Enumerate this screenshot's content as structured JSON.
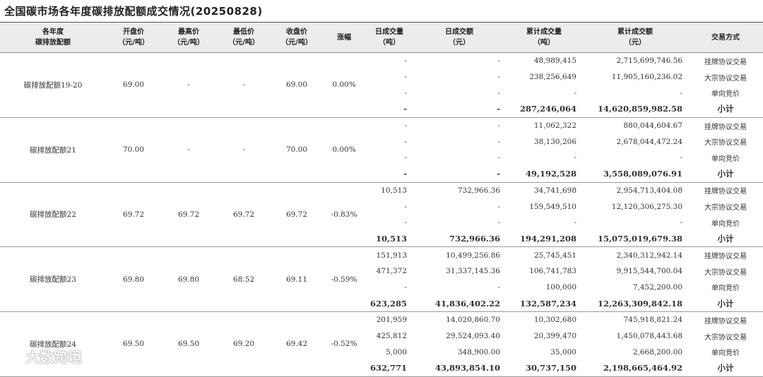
{
  "title": "全国碳市场各年度碳排放配额成交情况(20250828)",
  "headers": [
    [
      "各年度",
      "碳排放配额"
    ],
    [
      "开盘价",
      "（元/吨）"
    ],
    [
      "最高价",
      "（元/吨）"
    ],
    [
      "最低价",
      "（元/吨）"
    ],
    [
      "收盘价",
      "（元/吨）"
    ],
    [
      "涨幅"
    ],
    [
      "日成交量",
      "（吨）"
    ],
    [
      "日成交额",
      "（元）"
    ],
    [
      "累计成交量",
      "（吨）"
    ],
    [
      "累计成交额",
      "（元）"
    ],
    [
      "交易方式"
    ]
  ],
  "groups": [
    {
      "name": "碳排放配额19-20",
      "open": "69.00",
      "high": "-",
      "low": "-",
      "close": "69.00",
      "change": "0.00%",
      "rows": [
        {
          "vol": "-",
          "amt": "-",
          "cum_vol": "48,989,415",
          "cum_amt": "2,715,699,746.56",
          "method": "挂牌协议交易"
        },
        {
          "vol": "-",
          "amt": "-",
          "cum_vol": "238,256,649",
          "cum_amt": "11,905,160,236.02",
          "method": "大宗协议交易"
        },
        {
          "vol": "-",
          "amt": "-",
          "cum_vol": "-",
          "cum_amt": "-",
          "method": "单向竞价"
        },
        {
          "vol": "-",
          "amt": "-",
          "cum_vol": "287,246,064",
          "cum_amt": "14,620,859,982.58",
          "method": "小计"
        }
      ]
    },
    {
      "name": "碳排放配额21",
      "open": "70.00",
      "high": "-",
      "low": "-",
      "close": "70.00",
      "change": "0.00%",
      "rows": [
        {
          "vol": "-",
          "amt": "-",
          "cum_vol": "11,062,322",
          "cum_amt": "880,044,604.67",
          "method": "挂牌协议交易"
        },
        {
          "vol": "-",
          "amt": "-",
          "cum_vol": "38,130,206",
          "cum_amt": "2,678,044,472.24",
          "method": "大宗协议交易"
        },
        {
          "vol": "-",
          "amt": "-",
          "cum_vol": "-",
          "cum_amt": "-",
          "method": "单向竞价"
        },
        {
          "vol": "-",
          "amt": "-",
          "cum_vol": "49,192,528",
          "cum_amt": "3,558,089,076.91",
          "method": "小计"
        }
      ]
    },
    {
      "name": "碳排放配额22",
      "open": "69.72",
      "high": "69.72",
      "low": "69.72",
      "close": "69.72",
      "change": "-0.83%",
      "rows": [
        {
          "vol": "10,513",
          "amt": "732,966.36",
          "cum_vol": "34,741,698",
          "cum_amt": "2,954,713,404.08",
          "method": "挂牌协议交易"
        },
        {
          "vol": "-",
          "amt": "-",
          "cum_vol": "159,549,510",
          "cum_amt": "12,120,306,275.30",
          "method": "大宗协议交易"
        },
        {
          "vol": "-",
          "amt": "-",
          "cum_vol": "-",
          "cum_amt": "-",
          "method": "单向竞价"
        },
        {
          "vol": "10,513",
          "amt": "732,966.36",
          "cum_vol": "194,291,208",
          "cum_amt": "15,075,019,679.38",
          "method": "小计"
        }
      ]
    },
    {
      "name": "碳排放配额23",
      "open": "69.80",
      "high": "69.80",
      "low": "68.52",
      "close": "69.11",
      "change": "-0.59%",
      "rows": [
        {
          "vol": "151,913",
          "amt": "10,499,256.86",
          "cum_vol": "25,745,451",
          "cum_amt": "2,340,312,942.14",
          "method": "挂牌协议交易"
        },
        {
          "vol": "471,372",
          "amt": "31,337,145.36",
          "cum_vol": "106,741,783",
          "cum_amt": "9,915,544,700.04",
          "method": "大宗协议交易"
        },
        {
          "vol": "-",
          "amt": "-",
          "cum_vol": "100,000",
          "cum_amt": "7,452,200.00",
          "method": "单向竞价"
        },
        {
          "vol": "623,285",
          "amt": "41,836,402.22",
          "cum_vol": "132,587,234",
          "cum_amt": "12,263,309,842.18",
          "method": "小计"
        }
      ]
    },
    {
      "name": "碳排放配额24",
      "open": "69.50",
      "high": "69.50",
      "low": "69.20",
      "close": "69.42",
      "change": "-0.52%",
      "rows": [
        {
          "vol": "201,959",
          "amt": "14,020,860.70",
          "cum_vol": "10,302,680",
          "cum_amt": "745,918,821.24",
          "method": "挂牌协议交易"
        },
        {
          "vol": "425,812",
          "amt": "29,524,093.40",
          "cum_vol": "20,399,470",
          "cum_amt": "1,450,078,443.68",
          "method": "大宗协议交易"
        },
        {
          "vol": "5,000",
          "amt": "348,900.00",
          "cum_vol": "35,000",
          "cum_amt": "2,668,200.00",
          "method": "单向竞价"
        },
        {
          "vol": "632,771",
          "amt": "43,893,854.10",
          "cum_vol": "30,737,150",
          "cum_amt": "2,198,665,464.92",
          "method": "小计"
        }
      ]
    }
  ],
  "watermark": "大数跨境"
}
